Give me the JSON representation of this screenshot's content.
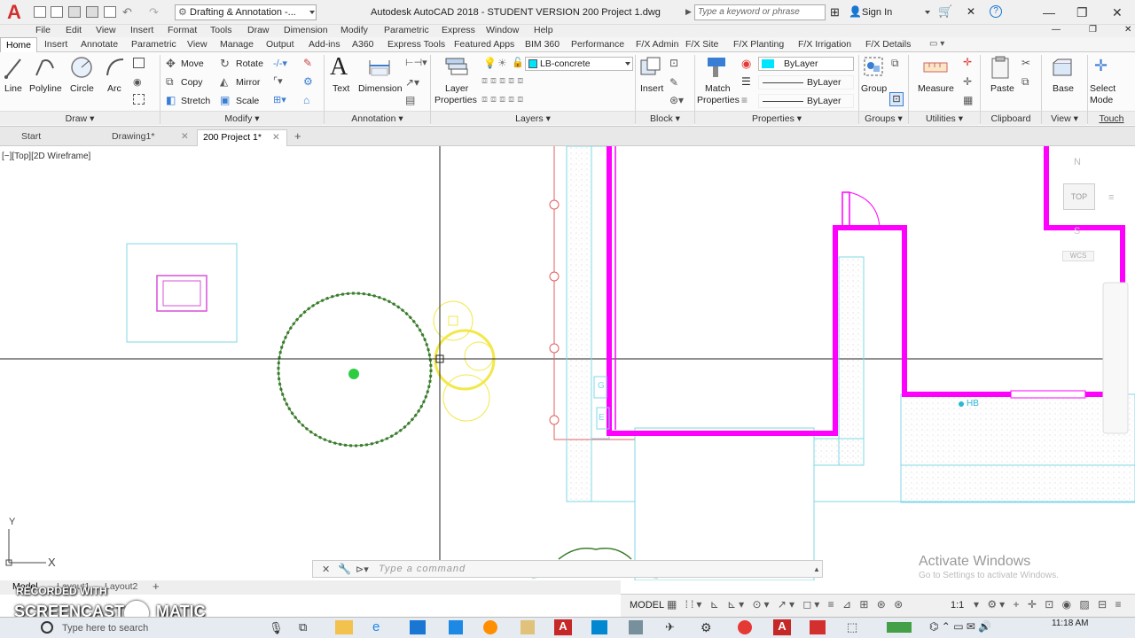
{
  "titlebar": {
    "workspace": "Drafting & Annotation -...",
    "window_title": "Autodesk AutoCAD 2018 - STUDENT VERSION    200 Project 1.dwg",
    "search_placeholder": "Type a keyword or phrase",
    "signin": "Sign In"
  },
  "menu": [
    "File",
    "Edit",
    "View",
    "Insert",
    "Format",
    "Tools",
    "Draw",
    "Dimension",
    "Modify",
    "Parametric",
    "Express",
    "Window",
    "Help"
  ],
  "ribbon_tabs": [
    "Home",
    "Insert",
    "Annotate",
    "Parametric",
    "View",
    "Manage",
    "Output",
    "Add-ins",
    "A360",
    "Express Tools",
    "Featured Apps",
    "BIM 360",
    "Performance",
    "F/X Admin",
    "F/X Site",
    "F/X Planting",
    "F/X Irrigation",
    "F/X Details"
  ],
  "draw_panel": {
    "title": "Draw",
    "line": "Line",
    "polyline": "Polyline",
    "circle": "Circle",
    "arc": "Arc"
  },
  "modify_panel": {
    "title": "Modify",
    "move": "Move",
    "rotate": "Rotate",
    "copy": "Copy",
    "mirror": "Mirror",
    "stretch": "Stretch",
    "scale": "Scale"
  },
  "annotation_panel": {
    "title": "Annotation",
    "text": "Text",
    "dimension": "Dimension"
  },
  "layers_panel": {
    "title": "Layers",
    "layer_properties_1": "Layer",
    "layer_properties_2": "Properties",
    "current_layer": "LB-concrete"
  },
  "block_panel": {
    "title": "Block",
    "insert": "Insert"
  },
  "properties_panel": {
    "title": "Properties",
    "match_1": "Match",
    "match_2": "Properties",
    "color": "ByLayer",
    "linetype": "ByLayer",
    "lineweight": "ByLayer"
  },
  "groups_panel": {
    "title": "Groups",
    "group": "Group"
  },
  "utilities_panel": {
    "title": "Utilities",
    "measure": "Measure"
  },
  "clipboard_panel": {
    "title": "Clipboard",
    "paste": "Paste"
  },
  "view_panel": {
    "title": "View",
    "base": "Base"
  },
  "touch_panel": {
    "title": "Touch",
    "select_1": "Select",
    "select_2": "Mode"
  },
  "file_tabs": [
    "Start",
    "Drawing1*",
    "200 Project 1*"
  ],
  "viewport_label": "[−][Top][2D Wireframe]",
  "viewcube": {
    "n": "N",
    "top": "TOP",
    "s": "S",
    "wcs": "WCS"
  },
  "ucs": {
    "y": "Y",
    "x": "X"
  },
  "drawing_labels": {
    "g": "G",
    "e": "E",
    "hb": "HB"
  },
  "command": {
    "placeholder": "Type a command"
  },
  "activate_windows": {
    "line1": "Activate Windows",
    "line2": "Go to Settings to activate Windows."
  },
  "layout_tabs": [
    "Model",
    "Layout1",
    "Layout2"
  ],
  "status": {
    "model": "MODEL",
    "scale": "1:1"
  },
  "taskbar": {
    "search": "Type here to search",
    "time": "11:18 AM"
  },
  "watermark": {
    "line1": "RECORDED WITH",
    "line2": "SCREENCAST",
    "line3": "MATIC"
  },
  "colors": {
    "magenta": "#ff00ff",
    "cyan": "#7fd7e6",
    "tree_green": "#3a7d2c",
    "yellow": "#f2e84a",
    "red": "#e06060"
  }
}
